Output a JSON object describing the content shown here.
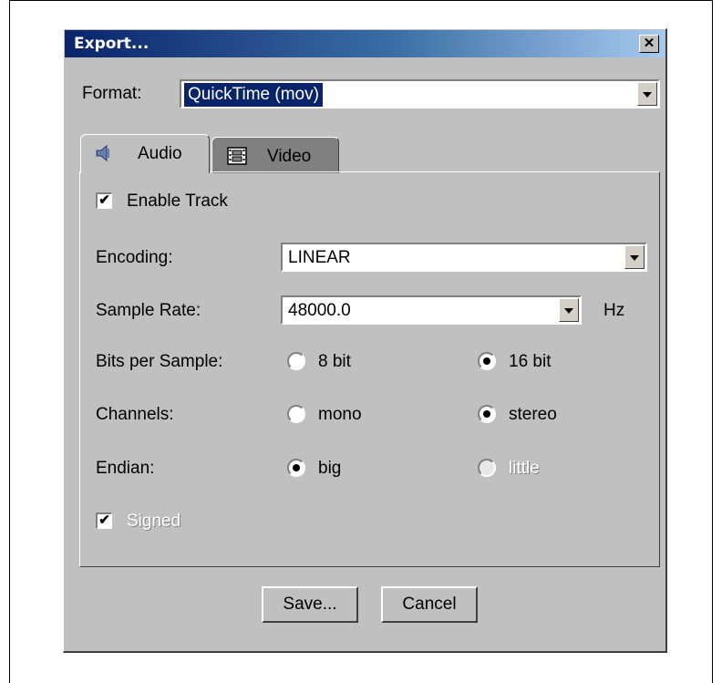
{
  "window": {
    "title": "Export...",
    "close_glyph": "✕"
  },
  "format": {
    "label": "Format:",
    "value": "QuickTime (mov)"
  },
  "tabs": [
    {
      "label": "Audio",
      "icon": "speaker-icon",
      "selected": true
    },
    {
      "label": "Video",
      "icon": "film-icon",
      "selected": false
    }
  ],
  "audio": {
    "enable_track": {
      "label": "Enable Track",
      "checked": true
    },
    "encoding": {
      "label": "Encoding:",
      "value": "LINEAR"
    },
    "sample_rate": {
      "label": "Sample Rate:",
      "value": "48000.0",
      "unit": "Hz"
    },
    "bits_per_sample": {
      "label": "Bits per Sample:",
      "options": [
        "8 bit",
        "16 bit"
      ],
      "selected": "16 bit"
    },
    "channels": {
      "label": "Channels:",
      "options": [
        "mono",
        "stereo"
      ],
      "selected": "stereo"
    },
    "endian": {
      "label": "Endian:",
      "options": [
        "big",
        "little"
      ],
      "selected": "big",
      "disabled_option": "little"
    },
    "signed": {
      "label": "Signed",
      "checked": true,
      "disabled": true
    }
  },
  "buttons": {
    "save": "Save...",
    "cancel": "Cancel"
  },
  "colors": {
    "title_bar": "#0a246a",
    "dialog_bg": "#c0c0c0",
    "selection": "#0a246a"
  }
}
